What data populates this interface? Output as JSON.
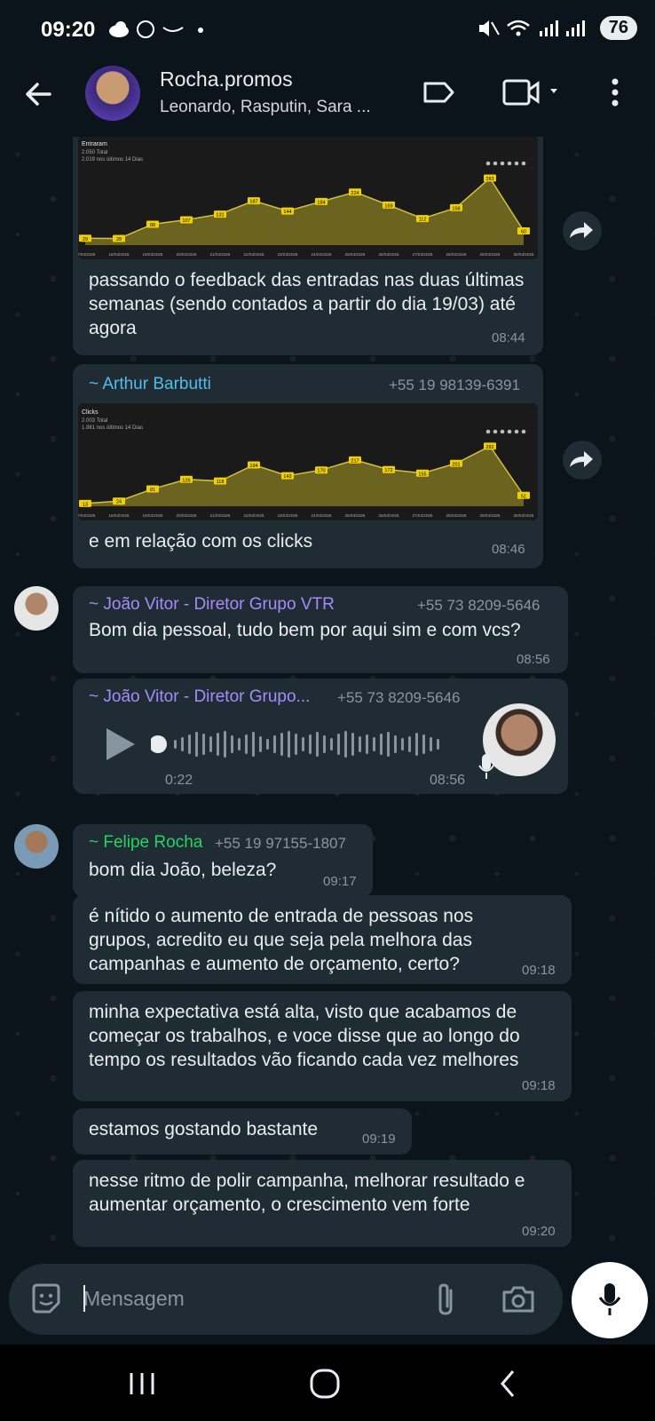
{
  "status_bar": {
    "time": "09:20",
    "battery": "76"
  },
  "header": {
    "title": "Rocha.promos",
    "subtitle": "Leonardo, Rasputin, Sara ..."
  },
  "messages": {
    "m1": {
      "text": "passando o feedback das entradas nas duas últimas semanas (sendo contados a partir do dia 19/03) até agora",
      "time": "08:44"
    },
    "m2": {
      "sender": "~ Arthur Barbutti",
      "phone": "+55 19 98139-6391",
      "text": "e em relação com os clicks",
      "time": "08:46"
    },
    "m3": {
      "sender": "~ João Vitor - Diretor Grupo VTR",
      "phone": "+55 73 8209-5646",
      "text": "Bom dia pessoal, tudo bem por aqui sim e com vcs?",
      "time": "08:56"
    },
    "m4": {
      "sender": "~ João Vitor - Diretor Grupo...",
      "phone": "+55 73 8209-5646",
      "duration": "0:22",
      "time": "08:56"
    },
    "m5": {
      "sender": "~ Felipe Rocha",
      "phone": "+55 19 97155-1807",
      "text": "bom dia João, beleza?",
      "time": "09:17"
    },
    "m6": {
      "text": "é nítido o aumento de entrada de pessoas nos grupos, acredito eu que seja pela melhora das campanhas e aumento de orçamento, certo?",
      "time": "09:18"
    },
    "m7": {
      "text": "minha expectativa está alta, visto que acabamos de começar os trabalhos, e voce disse que ao longo do tempo os resultados vão ficando cada vez melhores",
      "time": "09:18"
    },
    "m8": {
      "text": "estamos gostando bastante",
      "time": "09:19"
    },
    "m9": {
      "text": "nesse ritmo de polir campanha, melhorar resultado e aumentar orçamento, o crescimento vem forte",
      "time": "09:20"
    }
  },
  "input": {
    "placeholder": "Mensagem"
  },
  "chart_data": [
    {
      "type": "area",
      "title": "Entraram",
      "subtitle": "2.050 Total",
      "subtitle2": "2.019 nos últimos 14 Dias",
      "x": [
        "17/03/2026",
        "18/03/2026",
        "19/03/2026",
        "20/03/2026",
        "21/03/2026",
        "22/03/2026",
        "23/03/2026",
        "24/03/2026",
        "25/03/2026",
        "26/03/2026",
        "27/03/2026",
        "28/03/2026",
        "29/03/2026",
        "30/03/2026"
      ],
      "values": [
        29,
        28,
        88,
        107,
        131,
        187,
        144,
        184,
        224,
        169,
        112,
        158,
        283,
        60
      ]
    },
    {
      "type": "area",
      "title": "Clicks",
      "subtitle": "2.003 Total",
      "subtitle2": "1.981 nos últimos 14 Dias",
      "x": [
        "17/03/2026",
        "18/03/2026",
        "19/03/2026",
        "20/03/2026",
        "21/03/2026",
        "22/03/2026",
        "23/03/2026",
        "24/03/2026",
        "25/03/2026",
        "26/03/2026",
        "27/03/2026",
        "28/03/2026",
        "29/03/2026",
        "30/03/2026"
      ],
      "values": [
        13,
        24,
        81,
        126,
        118,
        194,
        143,
        170,
        217,
        172,
        155,
        201,
        282,
        51
      ]
    }
  ],
  "colors": {
    "bubble": "#1f2c34",
    "background": "#0b141a",
    "accent": "#25d366",
    "chart_line": "#d4c23a",
    "chart_fill": "#6b6320"
  }
}
